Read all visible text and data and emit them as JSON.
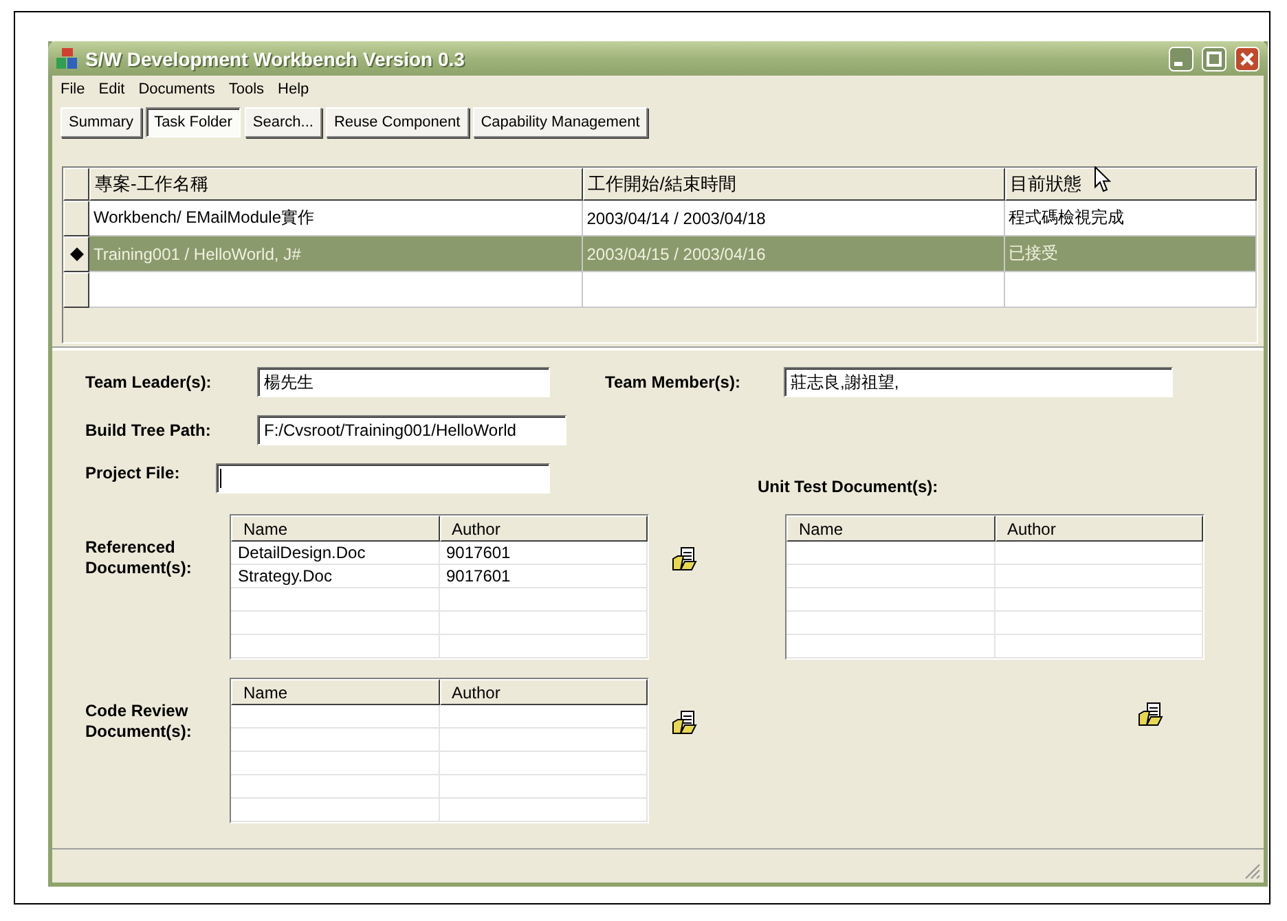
{
  "window": {
    "title": "S/W Development Workbench Version 0.3"
  },
  "menu": [
    "File",
    "Edit",
    "Documents",
    "Tools",
    "Help"
  ],
  "toolbar": [
    {
      "label": "Summary",
      "selected": false
    },
    {
      "label": "Task Folder",
      "selected": true
    },
    {
      "label": "Search...",
      "selected": false
    },
    {
      "label": "Reuse Component",
      "selected": false
    },
    {
      "label": "Capability Management",
      "selected": false
    }
  ],
  "task_table": {
    "columns": [
      "專案-工作名稱",
      "工作開始/結束時間",
      "目前狀態"
    ],
    "rows": [
      {
        "cells": [
          "Workbench/ EMailModule實作",
          "2003/04/14 / 2003/04/18",
          "程式碼檢視完成"
        ],
        "selected": false
      },
      {
        "cells": [
          "Training001 / HelloWorld, J#",
          "2003/04/15 / 2003/04/16",
          "已接受"
        ],
        "selected": true
      }
    ]
  },
  "form": {
    "team_leader": {
      "label": "Team Leader(s):",
      "value": "楊先生"
    },
    "team_member": {
      "label": "Team Member(s):",
      "value": "莊志良,謝祖望,"
    },
    "build_tree_path": {
      "label": "Build Tree Path:",
      "value": "F:/Cvsroot/Training001/HelloWorld"
    },
    "project_file": {
      "label": "Project File:"
    },
    "referenced_documents": {
      "label": "Referenced Document(s):",
      "columns": [
        "Name",
        "Author"
      ],
      "rows": [
        [
          "DetailDesign.Doc",
          "9017601"
        ],
        [
          "Strategy.Doc",
          "9017601"
        ]
      ]
    },
    "unit_test_documents": {
      "label": "Unit Test Document(s):",
      "columns": [
        "Name",
        "Author"
      ]
    },
    "code_review_documents": {
      "label": "Code Review Document(s):",
      "columns": [
        "Name",
        "Author"
      ]
    }
  }
}
